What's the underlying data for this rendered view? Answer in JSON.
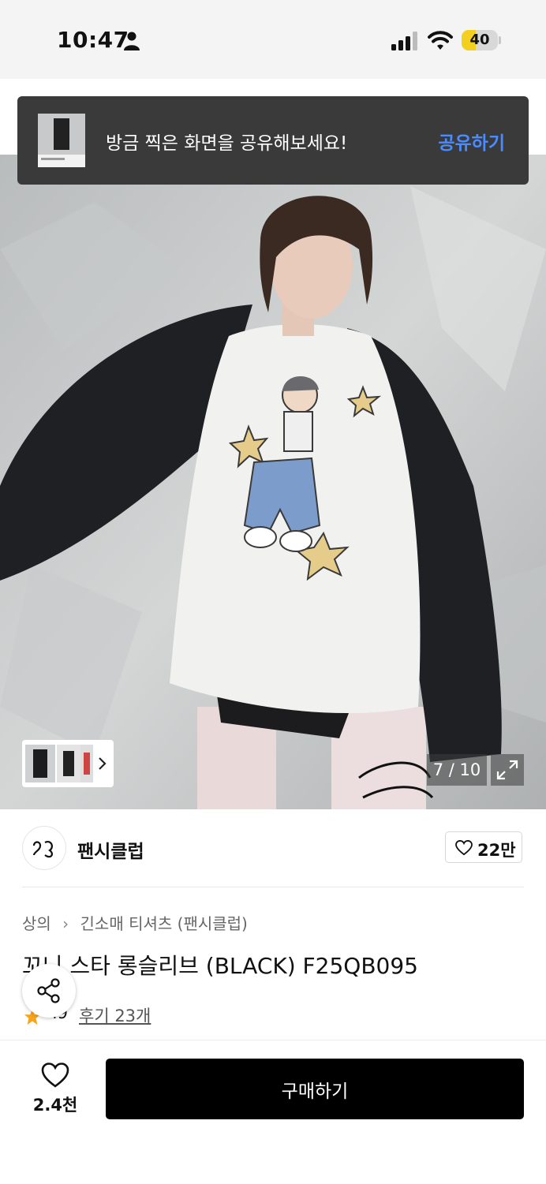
{
  "status_bar": {
    "time": "10:47",
    "battery": {
      "level": "40",
      "fraction": 0.4,
      "color": "#f4d01e"
    }
  },
  "toast": {
    "message": "방금 찍은 화면을 공유해보세요!",
    "action": "공유하기",
    "action_color": "#4a8cff"
  },
  "gallery": {
    "counter": "7 / 10",
    "current": 7,
    "total": 10
  },
  "brand": {
    "name": "팬시클럽",
    "like_count": "22만"
  },
  "breadcrumb": {
    "category": "상의",
    "separator_icon": "chevron-right-icon",
    "subcategory": "긴소매 티셔츠 (팬시클럽)"
  },
  "product": {
    "title": "꼬니 스타 롱슬리브 (BLACK) F25QB095",
    "rating": ".9",
    "reviews": "후기 23개"
  },
  "bottom_bar": {
    "wish_count": "2.4천",
    "buy_label": "구매하기"
  }
}
